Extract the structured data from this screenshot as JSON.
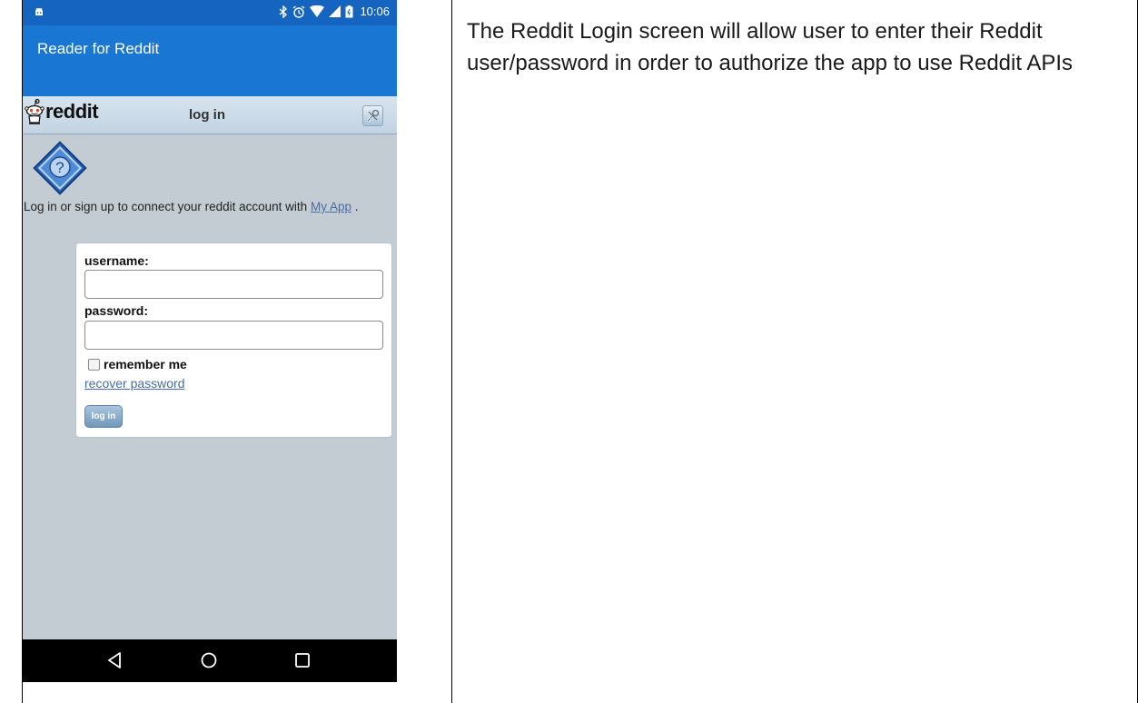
{
  "status_bar": {
    "time": "10:06",
    "icons": [
      "android-icon",
      "bluetooth-icon",
      "alarm-icon",
      "wifi-icon",
      "signal-icon",
      "battery-icon"
    ]
  },
  "app_bar": {
    "title": "Reader for Reddit"
  },
  "reddit_header": {
    "logo_text": "reddit",
    "title": "log in",
    "icon": "wrench-icon"
  },
  "intro": {
    "text_before": "Log in or sign up to connect your reddit account with ",
    "link_text": "My App",
    "text_after": " ."
  },
  "login_form": {
    "username_label": "username:",
    "username_value": "",
    "password_label": "password:",
    "password_value": "",
    "remember_label": "remember me",
    "remember_checked": false,
    "recover_link": "recover password",
    "login_button": "log in"
  },
  "nav_bar": {
    "icons": [
      "back-icon",
      "home-icon",
      "recents-icon"
    ]
  },
  "description": "The Reddit Login screen will allow user to enter their Reddit user/password in order to authorize the app to use Reddit APIs",
  "colors": {
    "status_bar": "#1565c0",
    "app_bar": "#1976d2",
    "page_bg": "#c4ccd3",
    "link": "#476cab"
  }
}
